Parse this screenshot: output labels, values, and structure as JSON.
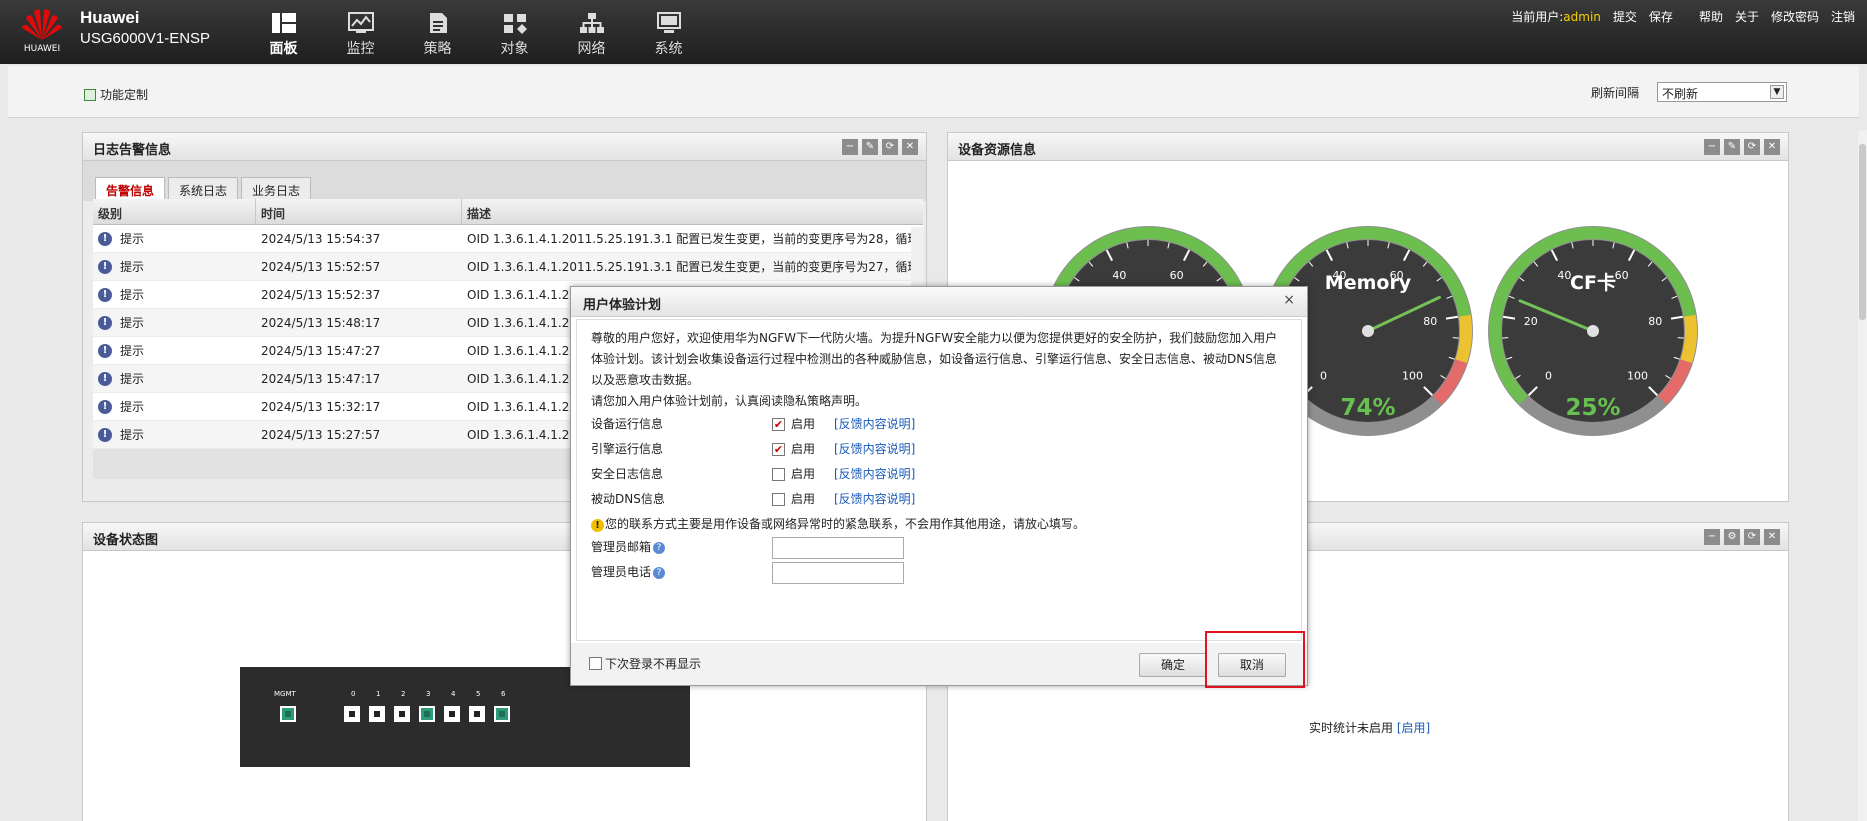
{
  "header": {
    "logo_text": "HUAWEI",
    "brand": "Huawei",
    "model": "USG6000V1-ENSP",
    "nav": [
      {
        "label": "面板",
        "icon": "dashboard-icon"
      },
      {
        "label": "监控",
        "icon": "monitor-icon"
      },
      {
        "label": "策略",
        "icon": "policy-icon"
      },
      {
        "label": "对象",
        "icon": "object-icon"
      },
      {
        "label": "网络",
        "icon": "network-icon"
      },
      {
        "label": "系统",
        "icon": "system-icon"
      }
    ],
    "current_user_label": "当前用户:",
    "current_user": "admin",
    "links": [
      "提交",
      "保存",
      "帮助",
      "关于",
      "修改密码",
      "注销"
    ]
  },
  "subbar": {
    "custom_label": "功能定制",
    "refresh_label": "刷新间隔",
    "refresh_value": "不刷新"
  },
  "log_panel": {
    "title": "日志告警信息",
    "tabs": [
      "告警信息",
      "系统日志",
      "业务日志"
    ],
    "columns": [
      "级别",
      "时间",
      "描述"
    ],
    "rows": [
      {
        "level": "提示",
        "time": "2024/5/13 15:54:37",
        "desc": "OID 1.3.6.1.4.1.2011.5.25.191.3.1 配置已发生变更，当前的变更序号为28，循环..."
      },
      {
        "level": "提示",
        "time": "2024/5/13 15:52:57",
        "desc": "OID 1.3.6.1.4.1.2011.5.25.191.3.1 配置已发生变更，当前的变更序号为27，循环..."
      },
      {
        "level": "提示",
        "time": "2024/5/13 15:52:37",
        "desc": "OID 1.3.6.1.4.1.20"
      },
      {
        "level": "提示",
        "time": "2024/5/13 15:48:17",
        "desc": "OID 1.3.6.1.4.1.20"
      },
      {
        "level": "提示",
        "time": "2024/5/13 15:47:27",
        "desc": "OID 1.3.6.1.4.1.20"
      },
      {
        "level": "提示",
        "time": "2024/5/13 15:47:17",
        "desc": "OID 1.3.6.1.4.1.20"
      },
      {
        "level": "提示",
        "time": "2024/5/13 15:32:17",
        "desc": "OID 1.3.6.1.4.1.20"
      },
      {
        "level": "提示",
        "time": "2024/5/13 15:27:57",
        "desc": "OID 1.3.6.1.4.1.20"
      }
    ]
  },
  "resource_panel": {
    "title": "设备资源信息",
    "gauges": [
      {
        "label": "",
        "value": 0,
        "ticks": [
          "40",
          "60"
        ]
      },
      {
        "label": "Memory",
        "value": 74,
        "display": "74%",
        "ticks": [
          "40",
          "60",
          "80",
          "100",
          "0"
        ]
      },
      {
        "label": "CF卡",
        "value": 25,
        "display": "25%",
        "ticks": [
          "40",
          "60",
          "20",
          "80",
          "0",
          "100"
        ]
      }
    ]
  },
  "device_panel": {
    "title": "设备状态图",
    "mgmt_label": "MGMT",
    "port_labels": [
      "0",
      "1",
      "2",
      "3",
      "4",
      "5",
      "6"
    ],
    "port_status": [
      "down",
      "down",
      "down",
      "up",
      "down",
      "down",
      "up"
    ]
  },
  "stats_panel": {
    "text": "实时统计未启用",
    "link": "[启用]"
  },
  "modal": {
    "title": "用户体验计划",
    "close": "×",
    "intro": "尊敬的用户您好，欢迎使用华为NGFW下一代防火墙。为提升NGFW安全能力以便为您提供更好的安全防护，我们鼓励您加入用户体验计划。该计划会收集设备运行过程中检测出的各种威胁信息，如设备运行信息、引擎运行信息、安全日志信息、被动DNS信息以及恶意攻击数据。",
    "notice": "请您加入用户体验计划前，认真阅读隐私策略声明。",
    "options": [
      {
        "label": "设备运行信息",
        "checked": true,
        "enable": "启用",
        "link": "[反馈内容说明]"
      },
      {
        "label": "引擎运行信息",
        "checked": true,
        "enable": "启用",
        "link": "[反馈内容说明]"
      },
      {
        "label": "安全日志信息",
        "checked": false,
        "enable": "启用",
        "link": "[反馈内容说明]"
      },
      {
        "label": "被动DNS信息",
        "checked": false,
        "enable": "启用",
        "link": "[反馈内容说明]"
      }
    ],
    "warning": "您的联系方式主要是用作设备或网络异常时的紧急联系，不会用作其他用途，请放心填写。",
    "email_label": "管理员邮箱",
    "phone_label": "管理员电话",
    "email_value": "",
    "phone_value": "",
    "no_more": "下次登录不再显示",
    "ok": "确定",
    "cancel": "取消"
  }
}
